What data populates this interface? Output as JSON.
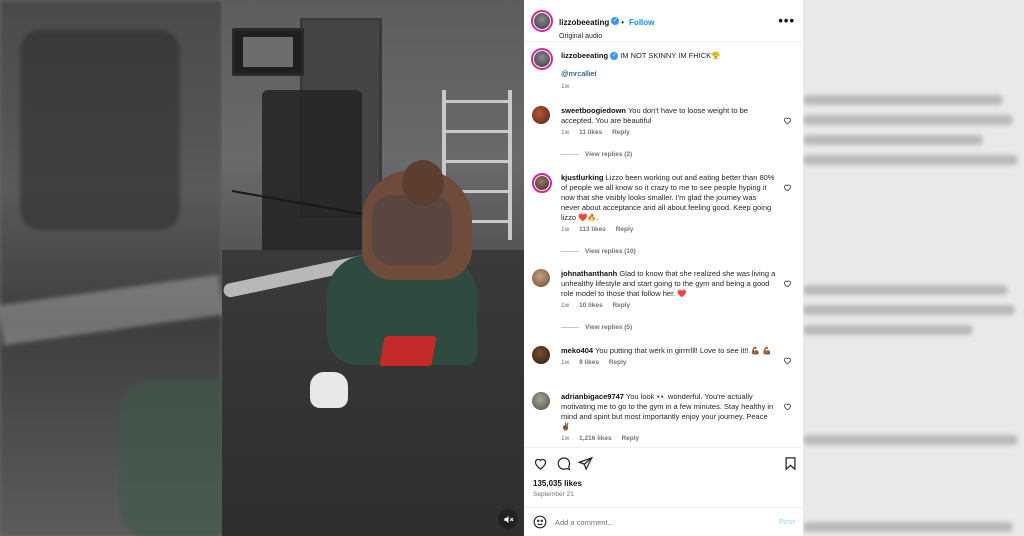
{
  "header": {
    "username": "lizzobeeating",
    "follow_label": "Follow",
    "audio_label": "Original audio",
    "more_label": "•••"
  },
  "caption": {
    "username": "lizzobeeating",
    "text": "IM NOT SKINNY IM FHICK😤",
    "mention": "@mrcalliet",
    "time": "1w"
  },
  "comments": [
    {
      "username": "sweetboogiedown",
      "text": "You don't have to loose weight to be accepted. You are beautiful",
      "time": "1w",
      "likes": "11 likes",
      "reply": "Reply",
      "view_replies": "View replies (2)"
    },
    {
      "username": "kjustlurking",
      "text": "Lizzo been working out and eating better than 80% of people we all know so it crazy to me to see people hyping it now that she visibly looks smaller. I'm glad the journey was never about acceptance and all about feeling good. Keep going lizzo ❤️🔥.",
      "time": "1w",
      "likes": "113 likes",
      "reply": "Reply",
      "view_replies": "View replies (10)"
    },
    {
      "username": "johnathanthanh",
      "text": "Glad to know that she realized she was living a unhealthy lifestyle and start going to the gym and being a good role model to those that follow her. ❤️",
      "time": "1w",
      "likes": "10 likes",
      "reply": "Reply",
      "view_replies": "View replies (5)"
    },
    {
      "username": "meko404",
      "text": "You putting that werk in girrrrlll! Love to see it!! 💪🏾 💪🏾",
      "time": "1w",
      "likes": "9 likes",
      "reply": "Reply"
    },
    {
      "username": "adrianbigace9747",
      "text": "You look 👀 wonderful. You're actually motivating me to go to the gym in a few minutes. Stay healthy in mind and spirit but most importantly enjoy your journey. Peace ✌🏾",
      "time": "1w",
      "likes": "1,216 likes",
      "reply": "Reply"
    }
  ],
  "actions": {
    "likes_count": "135,035 likes",
    "date": "September 21"
  },
  "add_comment": {
    "placeholder": "Add a comment...",
    "post_label": "Post"
  },
  "colors": {
    "accent": "#0095f6",
    "verified": "#3897f0",
    "like_heart": "#ed4956"
  }
}
